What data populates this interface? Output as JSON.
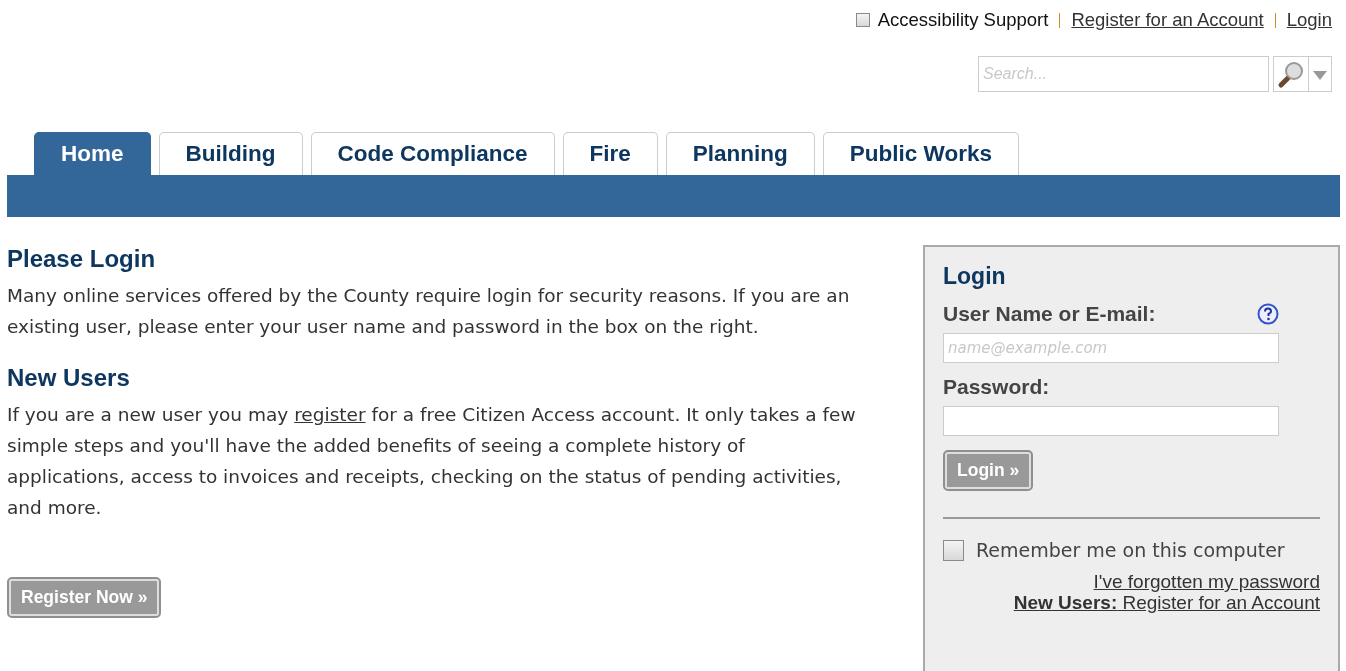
{
  "header": {
    "accessibility": {
      "label": "Accessibility Support",
      "checked": false
    },
    "links": [
      "Register for an Account",
      "Login"
    ],
    "search": {
      "placeholder": "Search..."
    }
  },
  "tabs": [
    {
      "label": "Home",
      "selected": true
    },
    {
      "label": "Building",
      "selected": false
    },
    {
      "label": "Code Compliance",
      "selected": false
    },
    {
      "label": "Fire",
      "selected": false
    },
    {
      "label": "Planning",
      "selected": false
    },
    {
      "label": "Public Works",
      "selected": false
    }
  ],
  "please_login": {
    "heading": "Please Login",
    "text": "Many online services offered by the County require login for security reasons. If you are an existing user, please enter your user name and password in the box on the right."
  },
  "new_users": {
    "heading": "New Users",
    "text_before": "If you are a new user you may",
    "link": "register",
    "text_after": "for a free Citizen Access account. It only takes a few simple steps and you'll have the added benefits of seeing a complete history of applications, access to invoices and receipts, checking on the status of pending activities, and more.",
    "button": "Register Now »"
  },
  "login_panel": {
    "title": "Login",
    "username_label": "User Name or E-mail:",
    "username_placeholder": "name@example.com",
    "password_label": "Password:",
    "button": "Login »",
    "remember": {
      "label": "Remember me on this computer",
      "checked": false
    },
    "forgot_link": "I've forgotten my password",
    "register_link": "**New Users:** Register for an Account"
  }
}
